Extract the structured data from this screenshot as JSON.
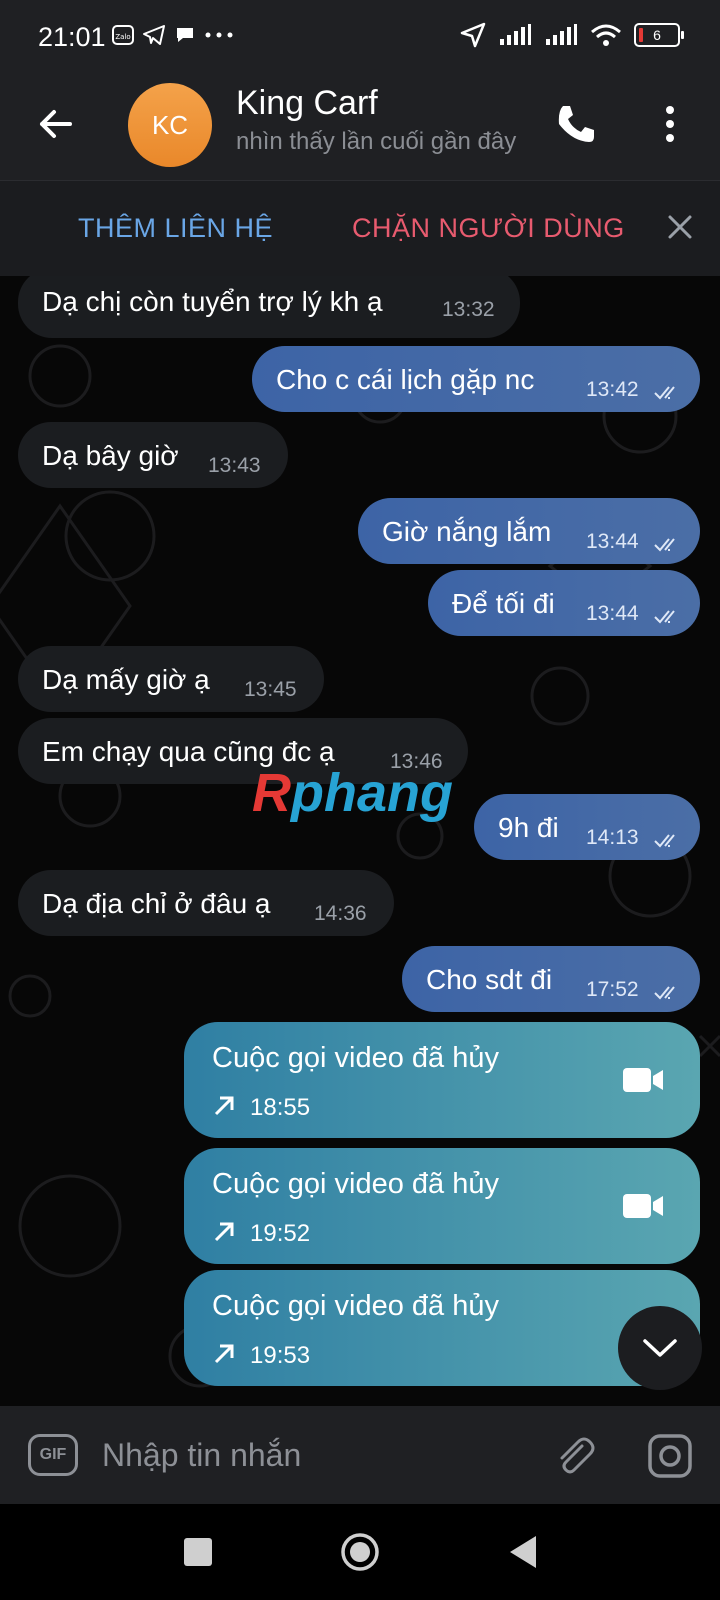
{
  "status_bar": {
    "time": "21:01",
    "battery_level": "6",
    "left_icons": [
      "zalo-icon",
      "telegram-icon",
      "chat-icon",
      "more-dots-icon"
    ],
    "right_icons": [
      "location-icon",
      "signal-icon",
      "signal-icon",
      "wifi-icon",
      "battery-icon"
    ]
  },
  "header": {
    "avatar_initials": "KC",
    "contact_name": "King Carf",
    "last_seen": "nhìn thấy lần cuối gần đây",
    "avatar_color": "#F09A3E"
  },
  "action_bar": {
    "add_contact": "THÊM LIÊN HỆ",
    "block_user": "CHẶN NGƯỜI DÙNG"
  },
  "messages": [
    {
      "direction": "in",
      "text": "Dạ chị còn tuyển trợ lý kh ạ",
      "time": "13:32"
    },
    {
      "direction": "out",
      "text": "Cho c cái lịch gặp nc",
      "time": "13:42",
      "read": true
    },
    {
      "direction": "in",
      "text": "Dạ bây giờ",
      "time": "13:43"
    },
    {
      "direction": "out",
      "text": "Giờ nắng lắm",
      "time": "13:44",
      "read": true
    },
    {
      "direction": "out",
      "text": "Để tối đi",
      "time": "13:44",
      "read": true
    },
    {
      "direction": "in",
      "text": "Dạ mấy giờ ạ",
      "time": "13:45"
    },
    {
      "direction": "in",
      "text": "Em chạy qua cũng đc ạ",
      "time": "13:46"
    },
    {
      "direction": "out",
      "text": "9h đi",
      "time": "14:13",
      "read": true
    },
    {
      "direction": "in",
      "text": "Dạ địa chỉ ở đâu ạ",
      "time": "14:36"
    },
    {
      "direction": "out",
      "text": "Cho sdt đi",
      "time": "17:52",
      "read": true
    }
  ],
  "calls": [
    {
      "title": "Cuộc gọi video đã hủy",
      "time": "18:55"
    },
    {
      "title": "Cuộc gọi video đã hủy",
      "time": "19:52"
    },
    {
      "title": "Cuộc gọi video đã hủy",
      "time": "19:53"
    }
  ],
  "watermark": {
    "first": "R",
    "rest": "phang"
  },
  "input": {
    "placeholder": "Nhập tin nhắn",
    "gif_label": "GIF"
  },
  "colors": {
    "outgoing_bubble": "#4168A8",
    "incoming_bubble": "#1B1D20",
    "call_bubble": "#3F93AA",
    "add_contact": "#6AA6E6",
    "block_user": "#E85B6F"
  }
}
